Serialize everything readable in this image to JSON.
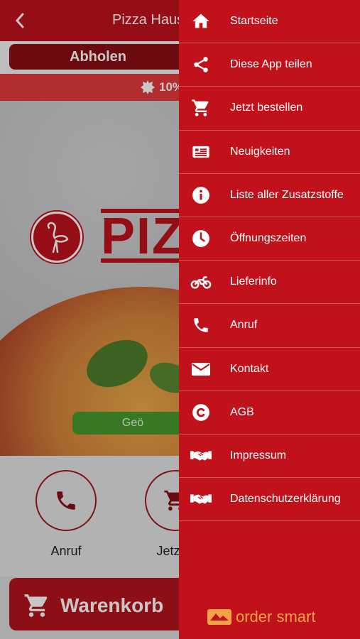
{
  "app": {
    "title": "Pizza Haus",
    "mode_tab": "Abholen",
    "promo_text": "10%",
    "logo_text": "PIZZ",
    "open_status": "Geö",
    "actions": [
      {
        "label": "Anruf"
      },
      {
        "label": "Jetzt b"
      }
    ],
    "cart_label": "Warenkorb"
  },
  "drawer": {
    "items": [
      {
        "label": "Startseite",
        "icon": "home-icon"
      },
      {
        "label": "Diese App teilen",
        "icon": "share-icon"
      },
      {
        "label": "Jetzt bestellen",
        "icon": "cart-icon"
      },
      {
        "label": "Neuigkeiten",
        "icon": "news-icon"
      },
      {
        "label": "Liste aller Zusatzstoffe",
        "icon": "info-icon"
      },
      {
        "label": "Öffnungszeiten",
        "icon": "clock-icon"
      },
      {
        "label": "Lieferinfo",
        "icon": "motorbike-icon"
      },
      {
        "label": "Anruf",
        "icon": "phone-icon"
      },
      {
        "label": "Kontakt",
        "icon": "mail-icon"
      },
      {
        "label": "AGB",
        "icon": "copyright-icon"
      },
      {
        "label": "Impressum",
        "icon": "handshake-icon"
      },
      {
        "label": "Datenschutzerklärung",
        "icon": "handshake-icon"
      }
    ],
    "brand": "order smart"
  },
  "colors": {
    "primary": "#c1121c",
    "dark_red": "#8a0f14",
    "promo": "#e53a3a",
    "open_green": "#4a9a2c",
    "brand_orange": "#f4a24a"
  }
}
